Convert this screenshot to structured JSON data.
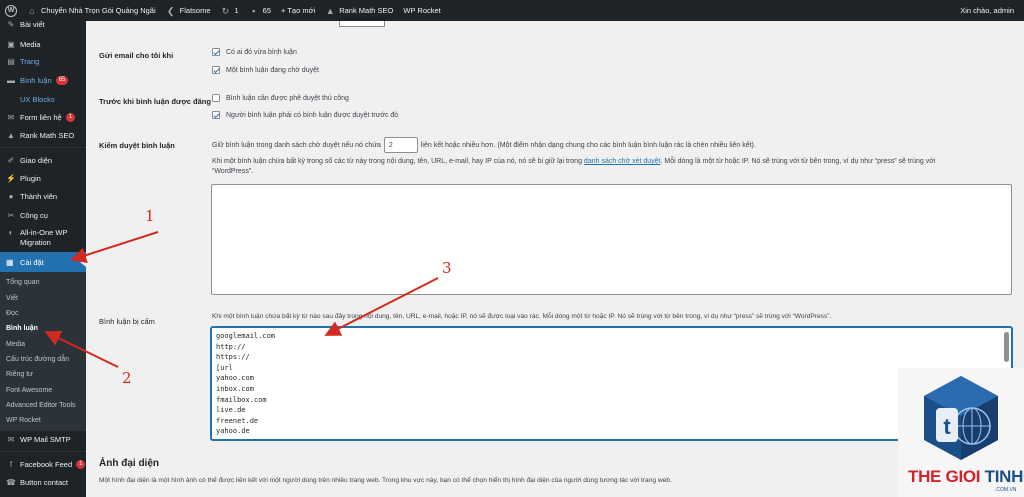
{
  "adminbar": {
    "site_name": "Chuyển Nhà Trọn Gói Quảng Ngãi",
    "theme": "Flatsome",
    "updates_count": "1",
    "comments_count": "65",
    "new_label": "+ Tạo mới",
    "rank_math": "Rank Math SEO",
    "wp_rocket": "WP Rocket",
    "greeting": "Xin chào, admin"
  },
  "sidebar": {
    "items": [
      {
        "label": "Bài viết",
        "icon": "pin-icon"
      },
      {
        "label": "Media",
        "icon": "media-icon"
      },
      {
        "label": "Trang",
        "icon": "page-icon"
      },
      {
        "label": "Bình luận",
        "icon": "comment-icon",
        "badge": "65"
      },
      {
        "label": "UX Blocks",
        "icon": "blocks-icon"
      },
      {
        "label": "Form liên hệ",
        "icon": "mail-icon",
        "badge": "1"
      },
      {
        "label": "Rank Math SEO",
        "icon": "chart-icon"
      },
      {
        "label": "Giao diện",
        "icon": "brush-icon"
      },
      {
        "label": "Plugin",
        "icon": "plugin-icon"
      },
      {
        "label": "Thành viên",
        "icon": "user-icon"
      },
      {
        "label": "Công cụ",
        "icon": "wrench-icon"
      },
      {
        "label": "All-in-One WP",
        "label2": "Migration",
        "icon": "migration-icon"
      },
      {
        "label": "Cài đặt",
        "icon": "settings-icon"
      }
    ],
    "submenu": [
      "Tổng quan",
      "Viết",
      "Đọc",
      "Bình luận",
      "Media",
      "Cấu trúc đường dẫn",
      "Riêng tư",
      "Font Awesome",
      "Advanced Editor Tools",
      "WP Rocket"
    ],
    "bottom_items": [
      {
        "label": "WP Mail SMTP",
        "icon": "mail-smtp-icon"
      },
      {
        "label": "Facebook Feed",
        "icon": "facebook-icon",
        "badge": "1"
      },
      {
        "label": "Button contact",
        "icon": "phone-icon"
      }
    ]
  },
  "settings": {
    "email_me": {
      "label": "Gửi email cho tôi khi",
      "opt1": "Có ai đó vừa bình luận",
      "opt2": "Một bình luận đang chờ duyệt"
    },
    "before_appears": {
      "label": "Trước khi bình luận được đăng",
      "opt1": "Bình luận cần được phê duyệt thủ công",
      "opt2": "Người bình luận phải có bình luận được duyệt trước đó"
    },
    "moderation": {
      "label": "Kiểm duyệt bình luận",
      "line1_a": "Giữ bình luận trong danh sách chờ duyệt nếu nó chứa",
      "links_value": "2",
      "line1_b": "liên kết hoặc nhiều hơn. (Một điểm nhận dạng chung cho các bình luận bình luận rác là chèn nhiều liên kết).",
      "line2_a": "Khi một bình luận chứa bất kỳ trong số các từ này trong nội dung, tên, URL, e-mail, hay IP của nó, nó sẽ bị giữ lại trong",
      "line2_link": "danh sách chờ xét duyệt",
      "line2_b": ". Mỗi dòng là một từ hoặc IP. Nó sẽ trùng với từ bên trong, ví dụ như “press” sẽ trùng với",
      "line3": "“WordPress”."
    },
    "disallowed": {
      "label": "Bình luận bị cấm",
      "desc": "Khi một bình luận chứa bất kỳ từ nào sau đây trong nội dung, tên, URL, e-mail, hoặc IP, nó sẽ được loại vào rác. Mỗi dòng một từ hoặc IP. Nó sẽ trùng với từ bên trong, ví dụ như “press” sẽ trùng với “WordPress”.",
      "keys": "googlemail.com\nhttp://\nhttps://\n[url\nyahoo.com\ninbox.com\nfmailbox.com\nlive.de\nfreenet.de\nyahoo.de"
    },
    "avatar": {
      "title": "Ảnh đại diện",
      "desc": "Một hình đại diện là một hình ảnh có thể được liên kết với một người dùng trên nhiều trang web. Trong khu vực này, bạn có thể chọn hiển thị hình đại diện của người dùng tương tác với trang web."
    }
  },
  "annotations": {
    "n1": "1",
    "n2": "2",
    "n3": "3",
    "color": "#d12a1f"
  },
  "logo": {
    "word1": "THE GIOI ",
    "word2": "TINHOC",
    "sub": ".COM.VN"
  }
}
